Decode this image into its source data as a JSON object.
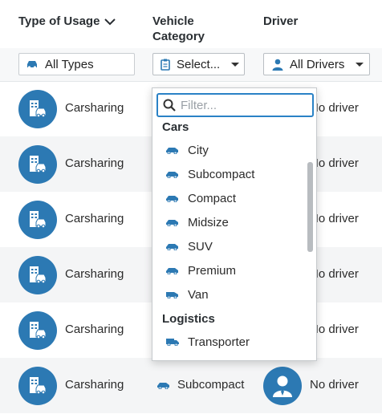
{
  "header": {
    "type_of_usage": "Type of Usage",
    "vehicle_category": "Vehicle Category",
    "driver": "Driver"
  },
  "filters": {
    "types_value": "All Types",
    "category_value": "Select...",
    "driver_value": "All Drivers"
  },
  "rows": [
    {
      "usage": "Carsharing",
      "driver": "No driver"
    },
    {
      "usage": "Carsharing",
      "driver": "No driver"
    },
    {
      "usage": "Carsharing",
      "driver": "No driver"
    },
    {
      "usage": "Carsharing",
      "driver": "No driver"
    },
    {
      "usage": "Carsharing",
      "driver": "No driver"
    },
    {
      "usage": "Carsharing",
      "category": "Subcompact",
      "driver": "No driver"
    }
  ],
  "dropdown": {
    "placeholder": "Filter...",
    "groups": [
      {
        "label": "Cars",
        "items": [
          "City",
          "Subcompact",
          "Compact",
          "Midsize",
          "SUV",
          "Premium",
          "Van"
        ]
      },
      {
        "label": "Logistics",
        "items": [
          "Transporter"
        ]
      }
    ]
  },
  "icons": {
    "usage_avatar": "carsharing-building-icon",
    "driver_avatar": "person-icon",
    "category_filter": "clipboard-icon",
    "driver_filter": "person-icon",
    "types_filter": "car-icon"
  },
  "colors": {
    "accent": "#2c79b3",
    "focus": "#2a82c6",
    "row_alt": "#f4f5f6"
  }
}
